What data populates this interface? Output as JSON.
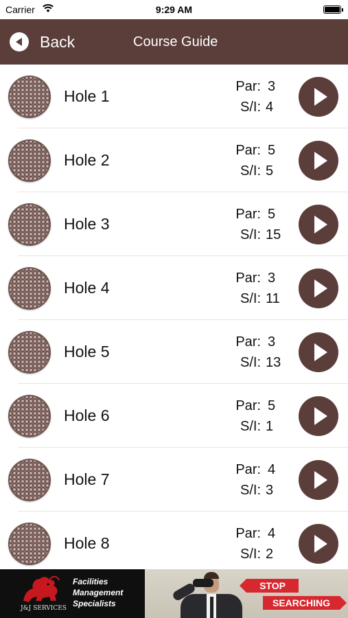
{
  "status_bar": {
    "carrier": "Carrier",
    "time": "9:29 AM"
  },
  "nav": {
    "back_label": "Back",
    "title": "Course Guide"
  },
  "labels": {
    "par": "Par:",
    "si": "S/I:"
  },
  "holes": [
    {
      "name": "Hole 1",
      "par": "3",
      "si": "4"
    },
    {
      "name": "Hole 2",
      "par": "5",
      "si": "5"
    },
    {
      "name": "Hole 3",
      "par": "5",
      "si": "15"
    },
    {
      "name": "Hole 4",
      "par": "3",
      "si": "11"
    },
    {
      "name": "Hole 5",
      "par": "3",
      "si": "13"
    },
    {
      "name": "Hole 6",
      "par": "5",
      "si": "1"
    },
    {
      "name": "Hole 7",
      "par": "4",
      "si": "3"
    },
    {
      "name": "Hole 8",
      "par": "4",
      "si": "2"
    }
  ],
  "ad": {
    "company": "J&J SERVICES",
    "tagline_1": "Facilities",
    "tagline_2": "Management",
    "tagline_3": "Specialists",
    "sign_1": "STOP",
    "sign_2": "SEARCHING"
  },
  "colors": {
    "brand": "#5b3d3a",
    "background": "#ffffff",
    "ad_accent": "#d7282f"
  },
  "icons": {
    "back": "chevron-left-circle-icon",
    "play": "play-circle-icon",
    "hole": "golf-ball-icon",
    "wifi": "wifi-icon",
    "battery": "battery-icon"
  }
}
